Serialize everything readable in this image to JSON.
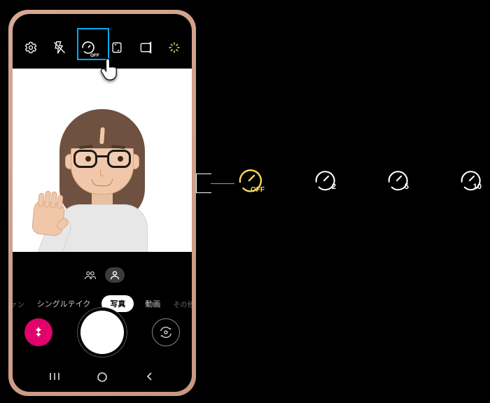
{
  "topbar": {
    "icons": [
      "settings",
      "flash-off",
      "timer-off",
      "aspect-ratio",
      "motion-photo",
      "effects"
    ],
    "timer_label": "OFF"
  },
  "highlight": {
    "target": "timer-icon"
  },
  "mid": {
    "group_icon": "group-selfie-icon",
    "single_icon": "single-selfie-icon"
  },
  "modes": {
    "items": [
      {
        "id": "fun",
        "label": "ァン"
      },
      {
        "id": "single-take",
        "label": "シングルテイク"
      },
      {
        "id": "photo",
        "label": "写真"
      },
      {
        "id": "video",
        "label": "動画"
      },
      {
        "id": "more",
        "label": "その他"
      }
    ],
    "active_id": "photo"
  },
  "shutter": {
    "gallery_icon": "flower-icon",
    "switch_icon": "camera-switch-icon"
  },
  "nav": {
    "recents": "|||",
    "home": "◯",
    "back": "‹"
  },
  "timer_options": [
    {
      "id": "off",
      "label": "OFF",
      "active": true
    },
    {
      "id": "2",
      "label": "2",
      "active": false
    },
    {
      "id": "5",
      "label": "5",
      "active": false
    },
    {
      "id": "10",
      "label": "10",
      "active": false
    }
  ]
}
